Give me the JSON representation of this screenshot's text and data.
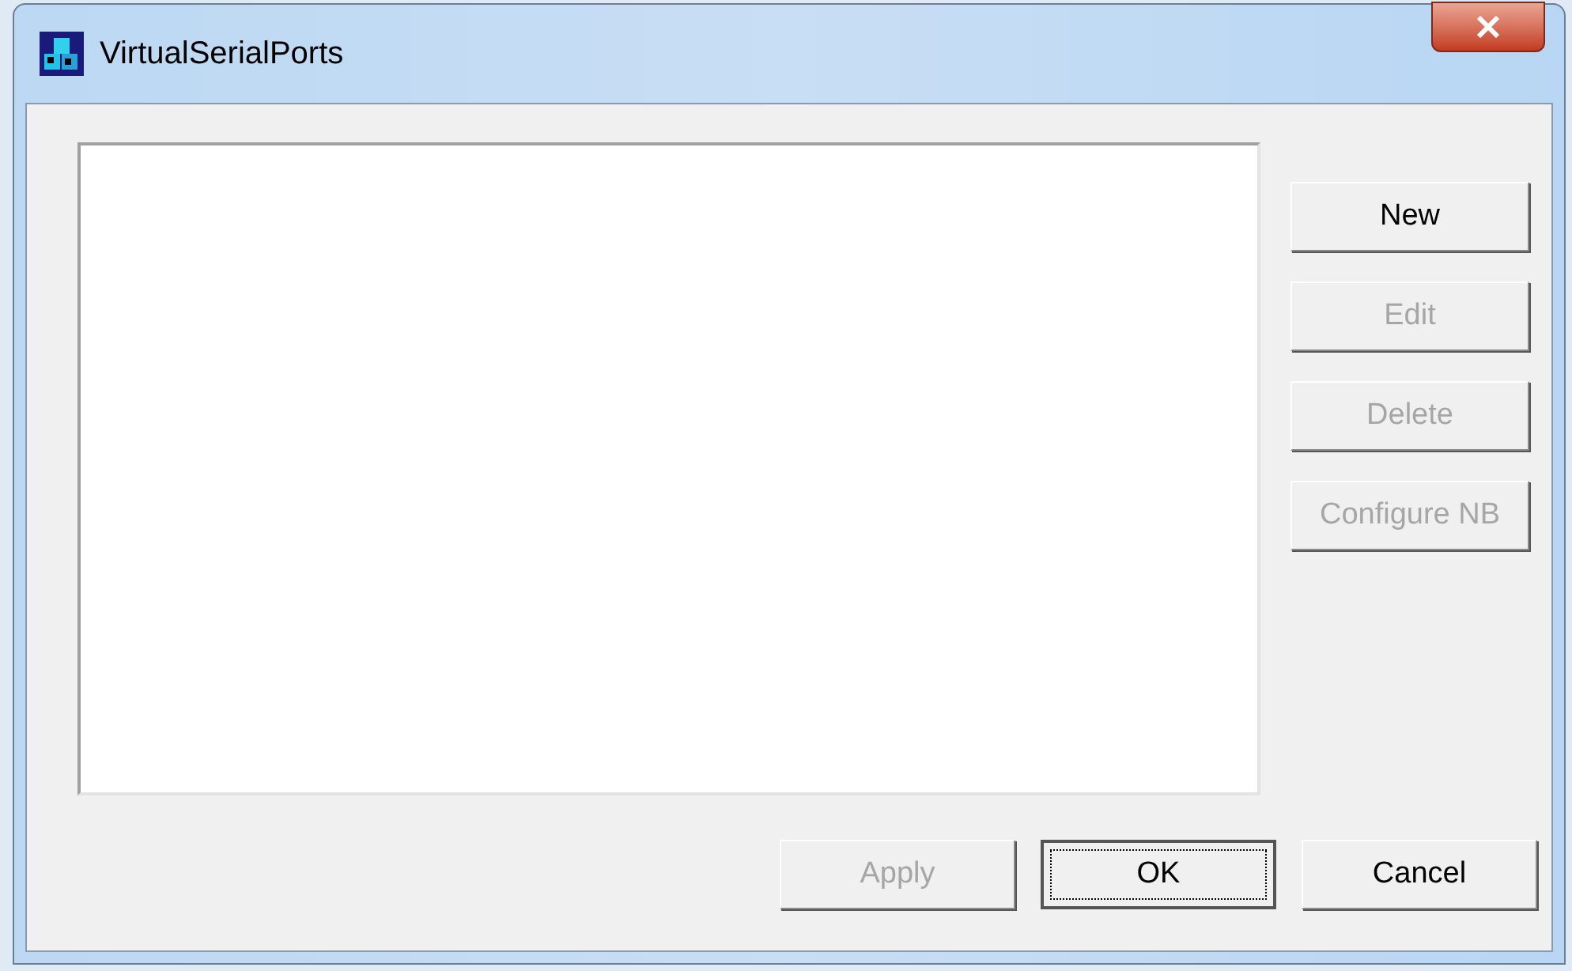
{
  "window": {
    "title": "VirtualSerialPorts"
  },
  "side_buttons": [
    {
      "label": "New",
      "disabled": false
    },
    {
      "label": "Edit",
      "disabled": true
    },
    {
      "label": "Delete",
      "disabled": true
    },
    {
      "label": "Configure NB",
      "disabled": true
    }
  ],
  "bottom_buttons": [
    {
      "label": "Apply",
      "disabled": true,
      "focused": false
    },
    {
      "label": "OK",
      "disabled": false,
      "focused": true
    },
    {
      "label": "Cancel",
      "disabled": false,
      "focused": false
    }
  ]
}
